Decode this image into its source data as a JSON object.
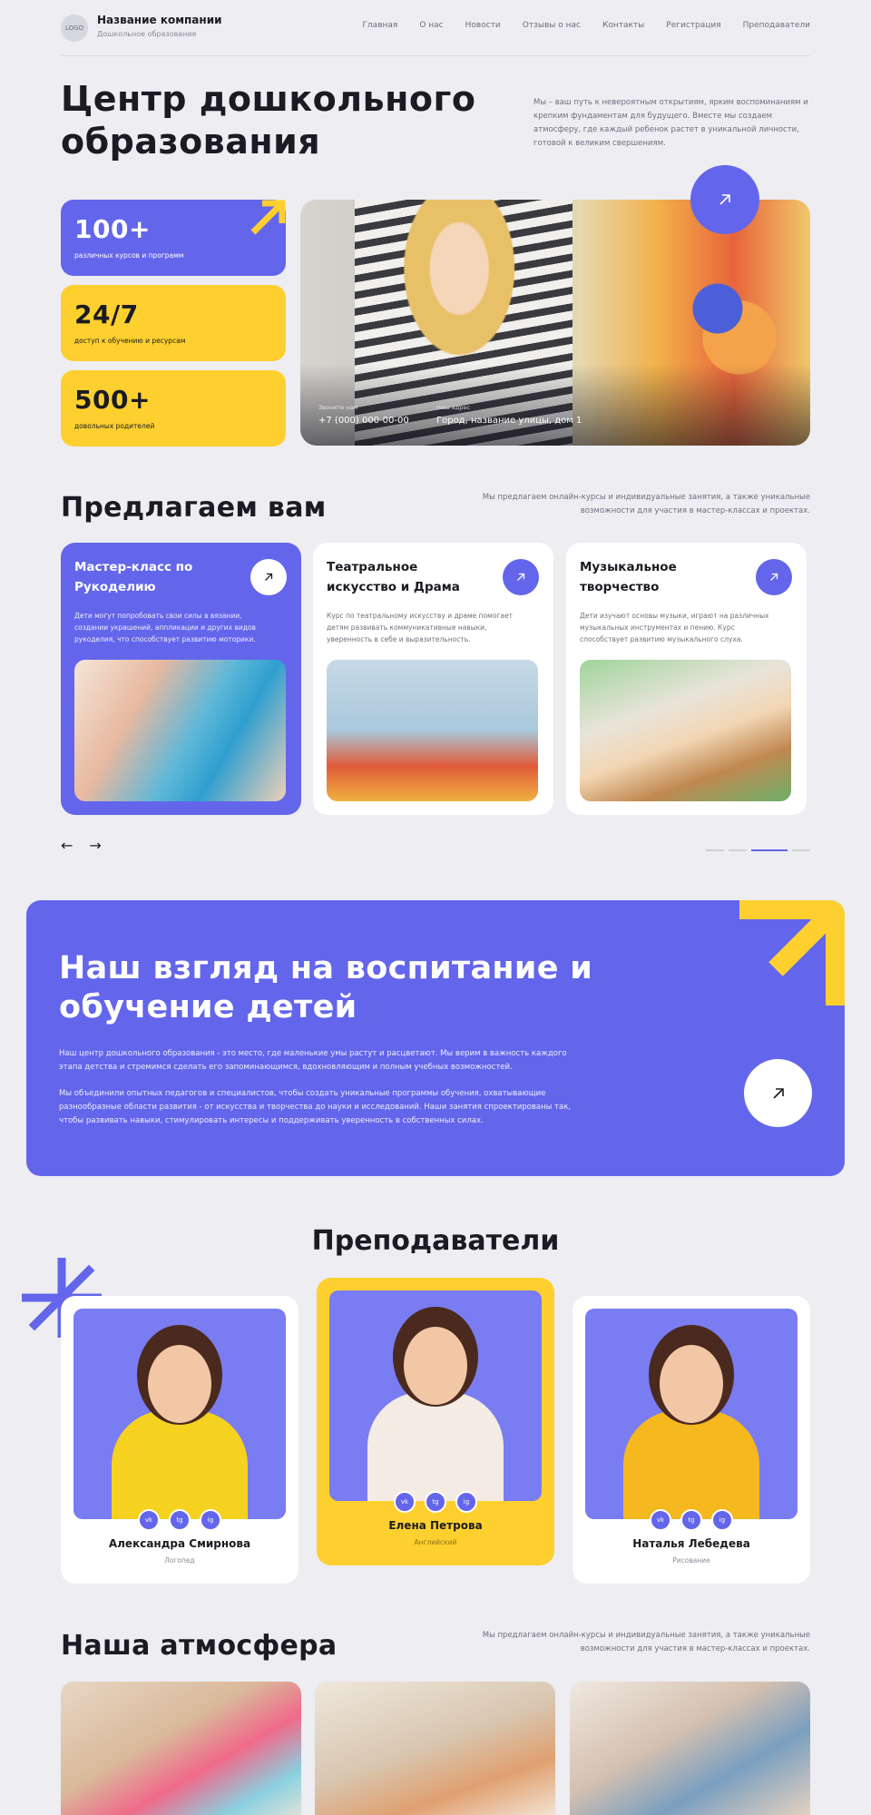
{
  "header": {
    "logo": "LOGO",
    "company": "Название компании",
    "subtitle": "Дошкольное образование",
    "nav": [
      "Главная",
      "О нас",
      "Новости",
      "Отзывы о нас",
      "Контакты",
      "Регистрация",
      "Преподаватели"
    ]
  },
  "hero": {
    "title_line1": "Центр дошкольного",
    "title_line2": "образования",
    "description": "Мы – ваш путь к невероятным открытиям, ярким воспоминаниям и крепким фундаментам для будущего. Вместе мы создаем атмосферу, где каждый ребенок растет в уникальной личности, готовой к великим свершениям.",
    "stats": [
      {
        "value": "100+",
        "label": "различных курсов и программ"
      },
      {
        "value": "24/7",
        "label": "доступ к обучению и ресурсам"
      },
      {
        "value": "500+",
        "label": "довольных родителей"
      }
    ],
    "phone_label": "Звоните нам",
    "phone": "+7 (000) 000-00-00",
    "address_label": "Наш адрес",
    "address": "Город, название улицы, дом 1"
  },
  "offers": {
    "title": "Предлагаем вам",
    "description": "Мы предлагаем онлайн-курсы и индивидуальные занятия, а также уникальные возможности для участия в мастер-классах и проектах.",
    "cards": [
      {
        "title": "Мастер-класс по Рукоделию",
        "text": "Дети могут попробовать свои силы в вязании, создании украшений, аппликации и других видов рукоделия, что способствует развитию моторики."
      },
      {
        "title": "Театральное искусство и Драма",
        "text": "Курс по театральному искусству и драме помогает детям развивать коммуникативные навыки, уверенность в себе и выразительность."
      },
      {
        "title": "Музыкальное творчество",
        "text": "Дети изучают основы музыки, играют на различных музыкальных инструментах и пению. Курс способствует развитию музыкального слуха."
      }
    ],
    "prev": "←",
    "next": "→"
  },
  "vision": {
    "title_line1": "Наш взгляд на воспитание и",
    "title_line2": "обучение детей",
    "p1": "Наш центр дошкольного образования - это место, где маленькие умы растут и расцветают. Мы верим в важность каждого этапа детства и стремимся сделать его запоминающимся, вдохновляющим и полным учебных возможностей.",
    "p2": "Мы объединили опытных педагогов и специалистов, чтобы создать уникальные программы обучения, охватывающие разнообразные области развития - от искусства и творчества до науки и исследований. Наши занятия спроектированы так, чтобы развивать навыки, стимулировать интересы и поддерживать уверенность в собственных силах."
  },
  "teachers": {
    "title": "Преподаватели",
    "list": [
      {
        "name": "Александра Смирнова",
        "role": "Логопед"
      },
      {
        "name": "Елена Петрова",
        "role": "Английский"
      },
      {
        "name": "Наталья Лебедева",
        "role": "Рисование"
      }
    ],
    "social": [
      "vk",
      "tg",
      "ig"
    ]
  },
  "atmosphere": {
    "title": "Наша атмосфера",
    "description": "Мы предлагаем онлайн-курсы и индивидуальные занятия, а также уникальные возможности для участия в мастер-классах и проектах."
  },
  "colors": {
    "accent": "#6366ea",
    "yellow": "#fed02f",
    "background": "#ededf2"
  }
}
